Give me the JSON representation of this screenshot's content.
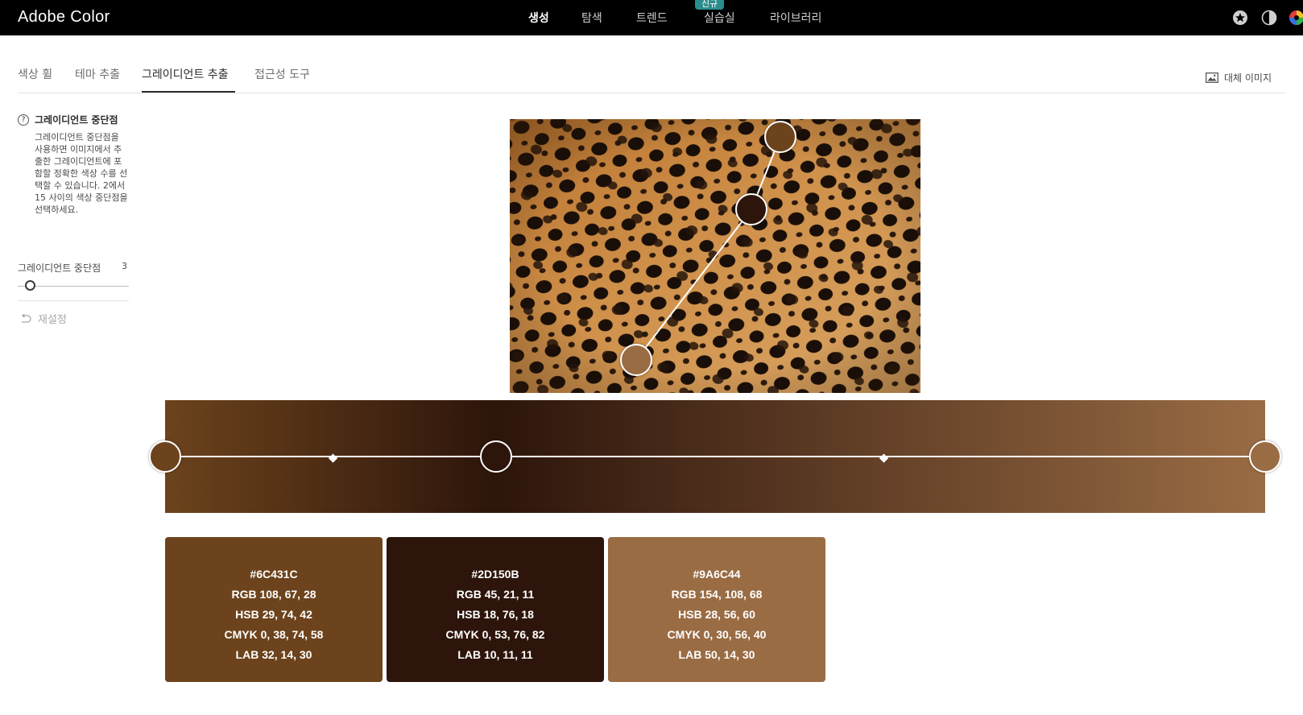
{
  "app": {
    "title": "Adobe Color"
  },
  "nav": {
    "items": [
      "생성",
      "탐색",
      "트렌드",
      "실습실",
      "라이브러리"
    ],
    "new_badge": "신규"
  },
  "subtabs": [
    "색상 휠",
    "테마 추출",
    "그레이디언트 추출",
    "접근성 도구"
  ],
  "alt_image_label": "대체 이미지",
  "sidebar": {
    "help_title": "그레이디언트 중단점",
    "help_text": "그레이디언트 중단점을 사용하면 이미지에서 추출한 그레이디언트에 포함할 정확한 색상 수를 선택할 수 있습니다. 2에서 15 사이의 색상 중단점을 선택하세요.",
    "slider_label": "그레이디언트 중단점",
    "slider_value": "3",
    "reset_label": "재설정"
  },
  "gradient": {
    "stops": [
      "#6C431C",
      "#2D150B",
      "#9A6C44"
    ]
  },
  "swatches": [
    {
      "hex": "#6C431C",
      "rgb": "RGB 108, 67, 28",
      "hsb": "HSB 29, 74, 42",
      "cmyk": "CMYK 0, 38, 74, 58",
      "lab": "LAB 32, 14, 30"
    },
    {
      "hex": "#2D150B",
      "rgb": "RGB 45, 21, 11",
      "hsb": "HSB 18, 76, 18",
      "cmyk": "CMYK 0, 53, 76, 82",
      "lab": "LAB 10, 11, 11"
    },
    {
      "hex": "#9A6C44",
      "rgb": "RGB 154, 108, 68",
      "hsb": "HSB 28, 56, 60",
      "cmyk": "CMYK 0, 30, 56, 40",
      "lab": "LAB 50, 14, 30"
    }
  ],
  "colors": {
    "accent_badge": "#2a8c8c",
    "topbar": "#000000"
  },
  "icons": [
    "star-icon",
    "theme-contrast-icon",
    "color-wheel-icon",
    "image-icon",
    "reset-icon",
    "help-icon"
  ]
}
